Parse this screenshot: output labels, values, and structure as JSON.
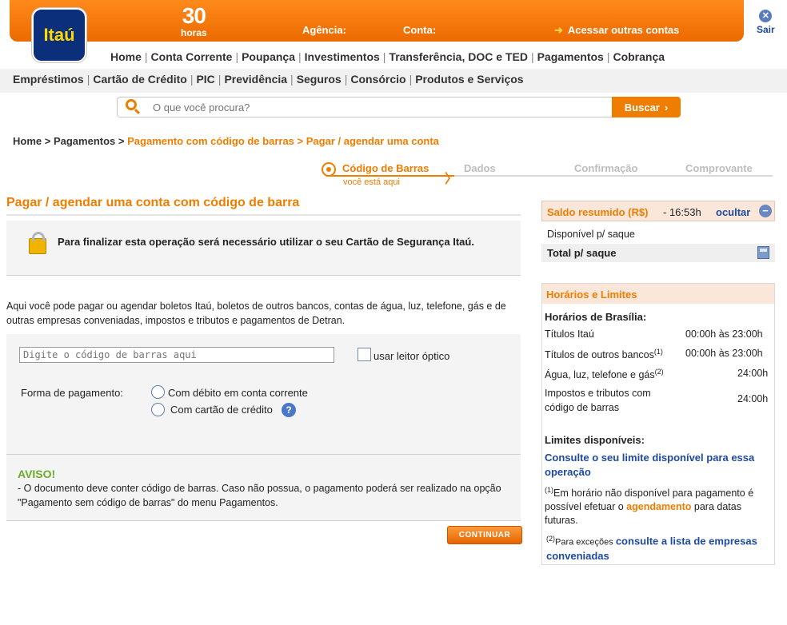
{
  "header": {
    "logo": "Itaú",
    "hours_number": "30",
    "hours_label": "horas",
    "agencia_label": "Agência:",
    "conta_label": "Conta:",
    "outras_contas": "Acessar outras contas",
    "sair": "Sair"
  },
  "nav": {
    "row1": [
      "Home",
      "Conta Corrente",
      "Poupança",
      "Investimentos",
      "Transferência, DOC e TED",
      "Pagamentos",
      "Cobrança"
    ],
    "row2": [
      "Empréstimos",
      "Cartão de Crédito",
      "PIC",
      "Previdência",
      "Seguros",
      "Consórcio",
      "Produtos e Serviços"
    ]
  },
  "search": {
    "placeholder": "O que você procura?",
    "button": "Buscar"
  },
  "breadcrumb": {
    "home": "Home",
    "pagamentos": "Pagamentos",
    "codigo": "Pagamento com código de barras",
    "atual": "Pagar / agendar uma conta",
    "separator": ">"
  },
  "steps": {
    "items": [
      "Código de Barras",
      "Dados",
      "Confirmação",
      "Comprovante"
    ],
    "you_are_here": "você está aqui"
  },
  "main": {
    "title": "Pagar / agendar uma conta com código de barra",
    "security_text": "Para finalizar esta operação será necessário utilizar o seu Cartão de Segurança Itaú.",
    "intro": "Aqui você pode pagar ou agendar boletos Itaú, boletos de outros bancos, contas de água, luz, telefone, gás e de outras empresas conveniadas, impostos e tributos e pagamentos de Detran.",
    "barcode_placeholder": "Digite o código de barras aqui",
    "leitor_label": "usar leitor óptico",
    "forma_label": "Forma de pagamento:",
    "opcao_debito": "Com débito em conta corrente",
    "opcao_cartao": "Com cartão de crédito",
    "help": "?",
    "aviso_title": "AVISO!",
    "aviso_text": "- O documento deve conter código de barras. Caso não possua, o pagamento poderá ser realizado na opção \"Pagamento sem código de barras\" do menu Pagamentos.",
    "continuar": "CONTINUAR"
  },
  "saldo": {
    "title": "Saldo resumido (R$)",
    "time": "- 16:53h",
    "ocultar": "ocultar",
    "disponivel": "Disponível p/ saque",
    "total": "Total p/ saque"
  },
  "limites": {
    "title": "Horários e Limites",
    "horarios_title": "Horários de Brasília:",
    "rows": [
      {
        "label": "Títulos Itaú",
        "sup": "",
        "value": "00:00h às 23:00h"
      },
      {
        "label": "Títulos de outros bancos",
        "sup": "(1)",
        "value": "00:00h às 23:00h"
      },
      {
        "label": "Água, luz, telefone e gás",
        "sup": "(2)",
        "value": "24:00h"
      },
      {
        "label": "Impostos e tributos com código de barras",
        "sup": "",
        "value": "24:00h"
      }
    ],
    "limites_title": "Limites disponíveis:",
    "consulte_limite": "Consulte o seu limite disponível para essa operação",
    "nota1_sup": "(1)",
    "nota1_pre": "Em horário não disponível para pagamento é possível efetuar o",
    "nota1_link": "agendamento",
    "nota1_post": "para datas futuras.",
    "nota2_sup": "(2)",
    "nota2_pre": "Para exceções",
    "nota2_link": "consulte a lista de empresas conveniadas"
  },
  "colors": {
    "orange": "#ef7d00",
    "blue": "#1e4aa0",
    "itau_blue": "#0b2f7a",
    "aviso_green": "#6aab2a"
  }
}
